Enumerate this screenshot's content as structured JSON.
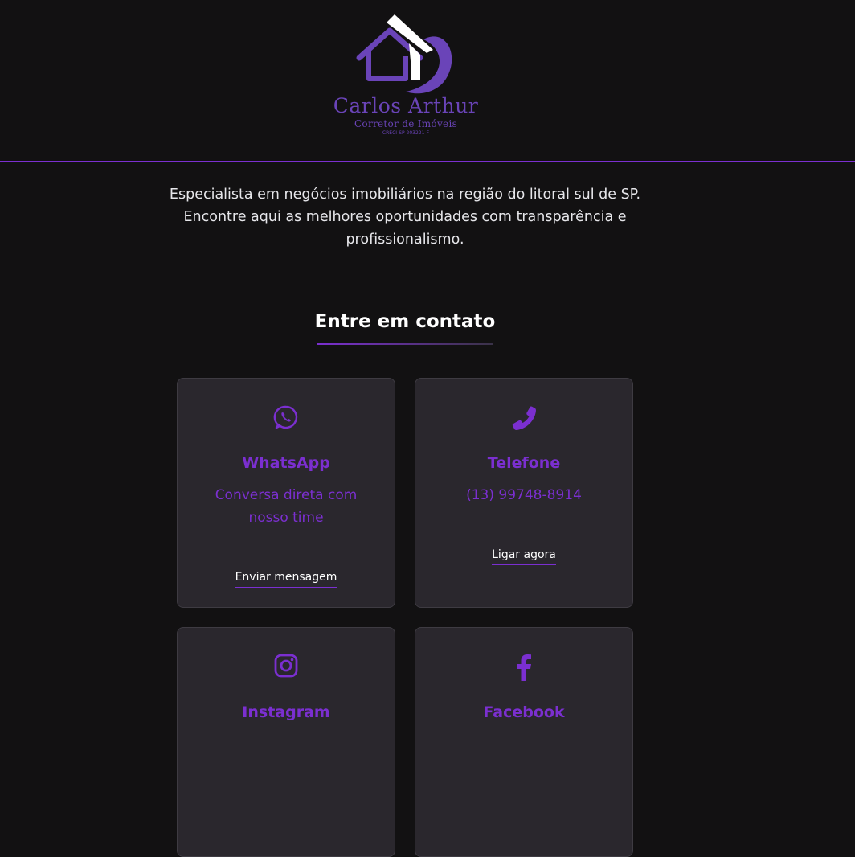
{
  "brand": {
    "name": "Carlos Arthur",
    "subtitle": "Corretor de Imóveis",
    "creci": "CRECI-SP 203221-F",
    "accent_color": "#7b2fd0",
    "logo_color": "#6a44b8"
  },
  "intro": {
    "text": "Especialista em negócios imobiliários na região do litoral sul de SP. Encontre aqui as melhores oportunidades com transparência e profissionalismo."
  },
  "contact": {
    "title": "Entre em contato",
    "cards": [
      {
        "icon": "whatsapp-icon",
        "title": "WhatsApp",
        "description": "Conversa direta com nosso time",
        "link_label": "Enviar mensagem"
      },
      {
        "icon": "phone-icon",
        "title": "Telefone",
        "description": "(13) 99748-8914",
        "link_label": "Ligar agora"
      },
      {
        "icon": "instagram-icon",
        "title": "Instagram"
      },
      {
        "icon": "facebook-icon",
        "title": "Facebook"
      }
    ]
  }
}
